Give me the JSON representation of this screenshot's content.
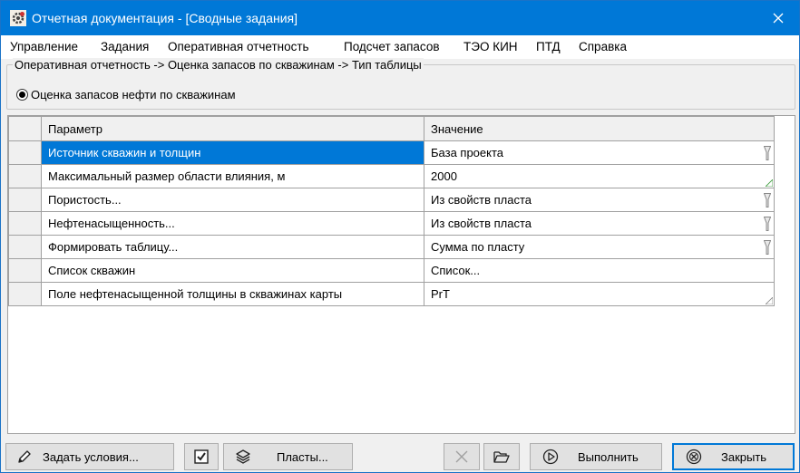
{
  "window": {
    "title": "Отчетная документация - [Сводные задания]",
    "accent": "#0078d7"
  },
  "menu": [
    "Управление",
    "Задания",
    "Оперативная отчетность",
    "Подсчет запасов",
    "ТЭО КИН",
    "ПТД",
    "Справка"
  ],
  "group": {
    "legend": "Оперативная отчетность -> Оценка запасов по скважинам -> Тип таблицы",
    "radio_label": "Оценка запасов нефти по скважинам",
    "radio_selected": true
  },
  "grid": {
    "headers": [
      "Параметр",
      "Значение"
    ],
    "rows": [
      {
        "param": "Источник скважин и толщин",
        "value": "База проекта",
        "control": "dropdown",
        "selected": true
      },
      {
        "param": "Максимальный размер области влияния, м",
        "value": "2000",
        "control": "edit"
      },
      {
        "param": "Пористость...",
        "value": "Из свойств пласта",
        "control": "dropdown"
      },
      {
        "param": "Нефтенасыщенность...",
        "value": "Из свойств пласта",
        "control": "dropdown"
      },
      {
        "param": "Формировать таблицу...",
        "value": "Сумма по пласту",
        "control": "dropdown"
      },
      {
        "param": "Список скважин",
        "value": "Список...",
        "control": "button"
      },
      {
        "param": "Поле нефтенасыщенной толщины в скважинах карты",
        "value": "PrT",
        "control": "edit"
      }
    ]
  },
  "toolbar": {
    "set_conditions": "Задать условия...",
    "layers": "Пласты...",
    "run": "Выполнить",
    "close": "Закрыть",
    "checkbox_checked": true
  },
  "icons": {
    "app": "app-gear-icon",
    "close": "close-icon",
    "pencil": "pencil-icon",
    "layers": "layers-icon",
    "delete": "delete-x-icon",
    "folder": "folder-open-icon",
    "run": "run-play-icon",
    "close_circle": "close-circle-icon"
  }
}
